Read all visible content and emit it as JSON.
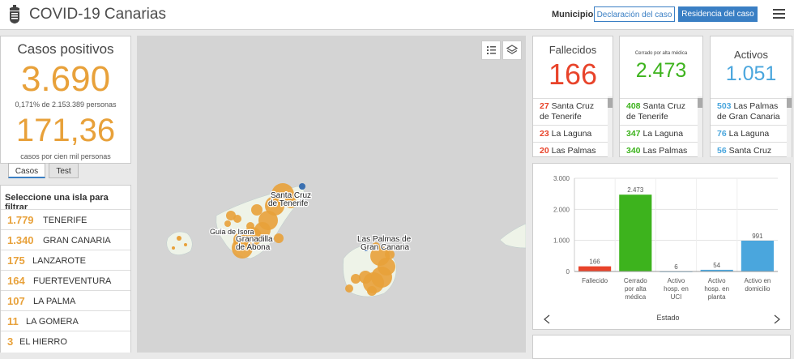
{
  "header": {
    "title": "COVID-19 Canarias",
    "municipio_label": "Municipio",
    "btn_declaracion": "Declaración del caso",
    "btn_residencia": "Residencia del caso"
  },
  "casos": {
    "title": "Casos positivos",
    "value": "3.690",
    "sub": "0,171% de 2.153.389 personas",
    "rate": "171,36",
    "rate_sub": "casos por cien mil personas"
  },
  "tabs": [
    "Casos",
    "Test"
  ],
  "islands": {
    "heading": "Seleccione una isla para filtrar",
    "items": [
      {
        "count": "1.779",
        "name": "TENERIFE"
      },
      {
        "count": "1.340",
        "name": "GRAN CANARIA"
      },
      {
        "count": "175",
        "name": "LANZAROTE"
      },
      {
        "count": "164",
        "name": "FUERTEVENTURA"
      },
      {
        "count": "107",
        "name": "LA PALMA"
      },
      {
        "count": "11",
        "name": "LA GOMERA"
      },
      {
        "count": "3",
        "name": "EL HIERRO"
      }
    ]
  },
  "map": {
    "labels": [
      "Santa Cruz",
      "de Tenerife",
      "Guía de Isora",
      "Granadilla",
      "de Abona",
      "Las Palmas de",
      "Gran Canaria"
    ]
  },
  "fallecidos": {
    "title": "Fallecidos",
    "value": "166",
    "color": "#e8432a",
    "rows": [
      {
        "count": "27",
        "name": "Santa Cruz",
        "name2": "de Tenerife"
      },
      {
        "count": "23",
        "name": "La Laguna",
        "name2": ""
      },
      {
        "count": "20",
        "name": "Las Palmas",
        "name2": ""
      }
    ]
  },
  "cerrados": {
    "small": "Cerrado por alta médica",
    "value": "2.473",
    "color": "#3db31d",
    "rows": [
      {
        "count": "408",
        "name": "Santa Cruz",
        "name2": "de Tenerife"
      },
      {
        "count": "347",
        "name": "La Laguna",
        "name2": ""
      },
      {
        "count": "340",
        "name": "Las Palmas",
        "name2": ""
      }
    ]
  },
  "activos": {
    "title": "Activos",
    "value": "1.051",
    "color": "#4aa6dd",
    "rows": [
      {
        "count": "503",
        "name": "Las Palmas",
        "name2": "de Gran Canaria"
      },
      {
        "count": "76",
        "name": "La Laguna",
        "name2": ""
      },
      {
        "count": "56",
        "name": "Santa Cruz",
        "name2": ""
      }
    ]
  },
  "chart_data": {
    "type": "bar",
    "categories": [
      "Fallecido",
      "Cerrado por alta médica",
      "Activo hosp. en UCI",
      "Activo hosp. en planta",
      "Activo en domicilio"
    ],
    "category_lines": [
      [
        "Fallecido"
      ],
      [
        "Cerrado",
        "por alta",
        "médica"
      ],
      [
        "Activo",
        "hosp. en",
        "UCI"
      ],
      [
        "Activo",
        "hosp. en",
        "planta"
      ],
      [
        "Activo en",
        "domicilio"
      ]
    ],
    "values": [
      166,
      2473,
      6,
      54,
      991
    ],
    "value_labels": [
      "166",
      "2.473",
      "6",
      "54",
      "991"
    ],
    "colors": [
      "#e8432a",
      "#3db31d",
      "#4aa6dd",
      "#4aa6dd",
      "#4aa6dd"
    ],
    "yticks": [
      "0",
      "1.000",
      "2.000",
      "3.000"
    ],
    "ylim": [
      0,
      3000
    ],
    "xlabel": "Estado",
    "ylabel": ""
  }
}
